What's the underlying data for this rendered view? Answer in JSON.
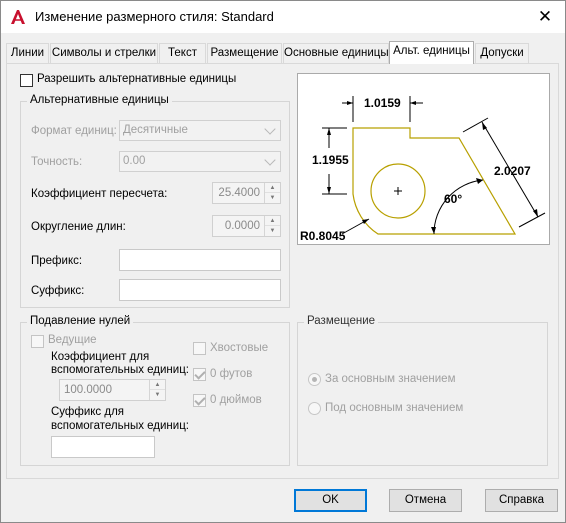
{
  "window": {
    "title": "Изменение размерного стиля: Standard",
    "close_glyph": "✕",
    "app_icon": "autocad-logo-icon",
    "accent_color": "#c8102e"
  },
  "tabs": [
    {
      "label": "Линии",
      "active": false
    },
    {
      "label": "Символы и стрелки",
      "active": false
    },
    {
      "label": "Текст",
      "active": false
    },
    {
      "label": "Размещение",
      "active": false
    },
    {
      "label": "Основные единицы",
      "active": false
    },
    {
      "label": "Альт. единицы",
      "active": true
    },
    {
      "label": "Допуски",
      "active": false
    }
  ],
  "enable_alt": {
    "label": "Разрешить альтернативные единицы",
    "checked": false
  },
  "alt_units": {
    "title": "Альтернативные единицы",
    "format_label": "Формат единиц:",
    "format_value": "Десятичные",
    "precision_label": "Точность:",
    "precision_value": "0.00",
    "multiplier_label": "Коэффициент пересчета:",
    "multiplier_value": "25.4000",
    "round_label": "Округление длин:",
    "round_value": "0.0000",
    "prefix_label": "Префикс:",
    "prefix_value": "",
    "suffix_label": "Суффикс:",
    "suffix_value": ""
  },
  "preview": {
    "dim_top": "1.0159",
    "dim_left": "1.1955",
    "dim_right": "2.0207",
    "dim_angle": "60°",
    "dim_radius": "R0.8045",
    "shape_color": "#b8a000"
  },
  "zero_suppression": {
    "title": "Подавление нулей",
    "leading_label": "Ведущие",
    "leading_checked": false,
    "trailing_label": "Хвостовые",
    "trailing_checked": false,
    "subunit_factor_label_1": "Коэффициент для",
    "subunit_factor_label_2": "вспомогательных единиц:",
    "subunit_factor_value": "100.0000",
    "zero_feet_label": "0 футов",
    "zero_feet_checked": true,
    "zero_inches_label": "0 дюймов",
    "zero_inches_checked": true,
    "subunit_suffix_label_1": "Суффикс для",
    "subunit_suffix_label_2": "вспомогательных единиц:",
    "subunit_suffix_value": ""
  },
  "placement": {
    "title": "Размещение",
    "after_label": "За основным значением",
    "after_selected": true,
    "below_label": "Под основным значением",
    "below_selected": false
  },
  "buttons": {
    "ok": "OK",
    "cancel": "Отмена",
    "help": "Справка"
  }
}
